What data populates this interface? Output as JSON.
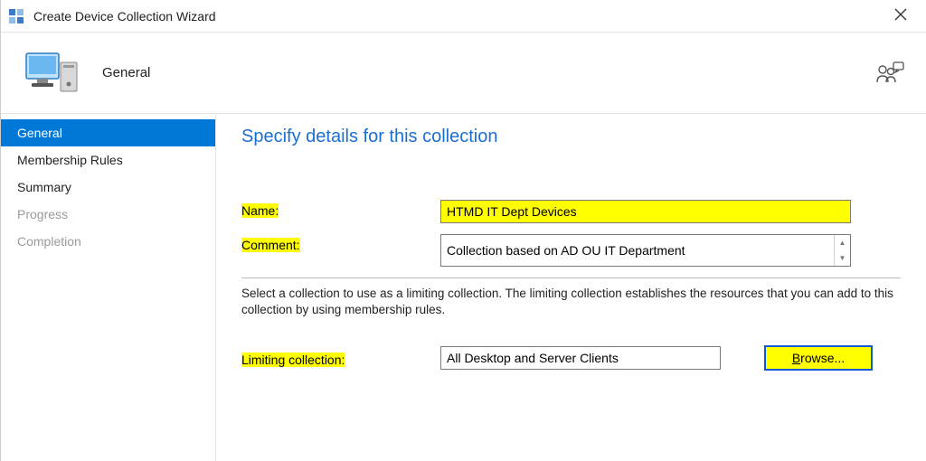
{
  "titlebar": {
    "title": "Create Device Collection Wizard"
  },
  "header": {
    "step_name": "General"
  },
  "sidebar": {
    "items": [
      {
        "label": "General",
        "state": "active"
      },
      {
        "label": "Membership Rules",
        "state": "normal"
      },
      {
        "label": "Summary",
        "state": "normal"
      },
      {
        "label": "Progress",
        "state": "disabled"
      },
      {
        "label": "Completion",
        "state": "disabled"
      }
    ]
  },
  "content": {
    "page_title": "Specify details for this collection",
    "name_label": "Name:",
    "name_value": "HTMD IT Dept Devices",
    "comment_label": "Comment:",
    "comment_value": "Collection based on AD OU IT Department",
    "help_text": "Select a collection to use as a limiting collection. The limiting collection establishes the resources that you can add to this collection by using membership rules.",
    "limiting_label": "Limiting collection:",
    "limiting_value": "All Desktop and Server Clients",
    "browse_label": "Browse..."
  }
}
